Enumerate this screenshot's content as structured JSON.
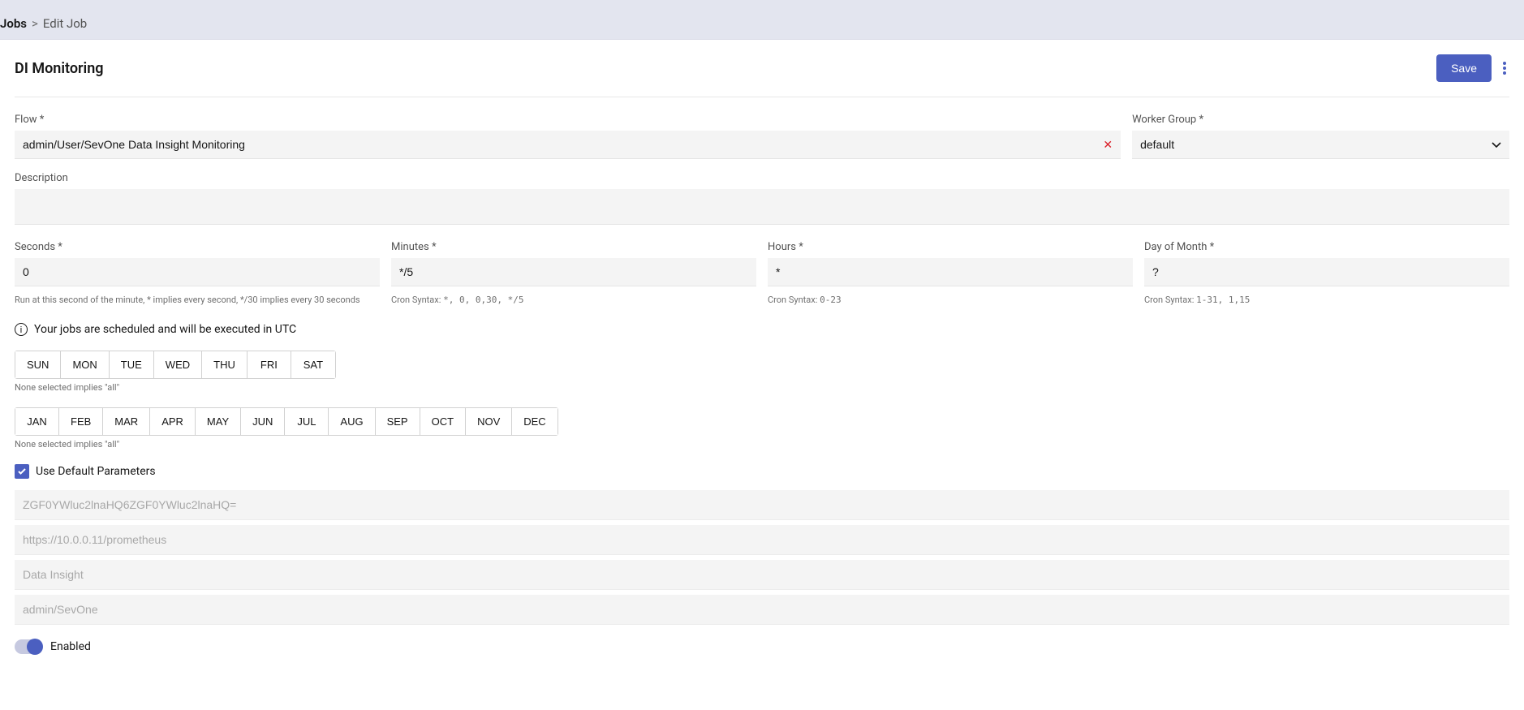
{
  "breadcrumb": {
    "root": "Jobs",
    "sep": ">",
    "current": "Edit Job"
  },
  "header": {
    "title": "DI Monitoring",
    "save": "Save"
  },
  "flow": {
    "label": "Flow",
    "value": "admin/User/SevOne Data Insight Monitoring"
  },
  "workerGroup": {
    "label": "Worker Group",
    "value": "default"
  },
  "description": {
    "label": "Description",
    "value": ""
  },
  "cron": {
    "seconds": {
      "label": "Seconds",
      "value": "0",
      "helper": "Run at this second of the minute, * implies every second, */30 implies every 30 seconds"
    },
    "minutes": {
      "label": "Minutes",
      "value": "*/5",
      "helperPrefix": "Cron Syntax: ",
      "helperCode": "*, 0, 0,30, */5"
    },
    "hours": {
      "label": "Hours",
      "value": "*",
      "helperPrefix": "Cron Syntax: ",
      "helperCode": "0-23"
    },
    "dom": {
      "label": "Day of Month",
      "value": "?",
      "helperPrefix": "Cron Syntax: ",
      "helperCode": "1-31, 1,15"
    }
  },
  "utcNote": "Your jobs are scheduled and will be executed in UTC",
  "days": [
    "SUN",
    "MON",
    "TUE",
    "WED",
    "THU",
    "FRI",
    "SAT"
  ],
  "months": [
    "JAN",
    "FEB",
    "MAR",
    "APR",
    "MAY",
    "JUN",
    "JUL",
    "AUG",
    "SEP",
    "OCT",
    "NOV",
    "DEC"
  ],
  "noneSelectedHelper": "None selected implies \"all\"",
  "defaultParams": {
    "label": "Use Default Parameters",
    "checked": true,
    "params": [
      "ZGF0YWluc2lnaHQ6ZGF0YWluc2lnaHQ=",
      "https://10.0.0.11/prometheus",
      "Data Insight",
      "admin/SevOne"
    ]
  },
  "enabled": {
    "label": "Enabled",
    "on": true
  }
}
